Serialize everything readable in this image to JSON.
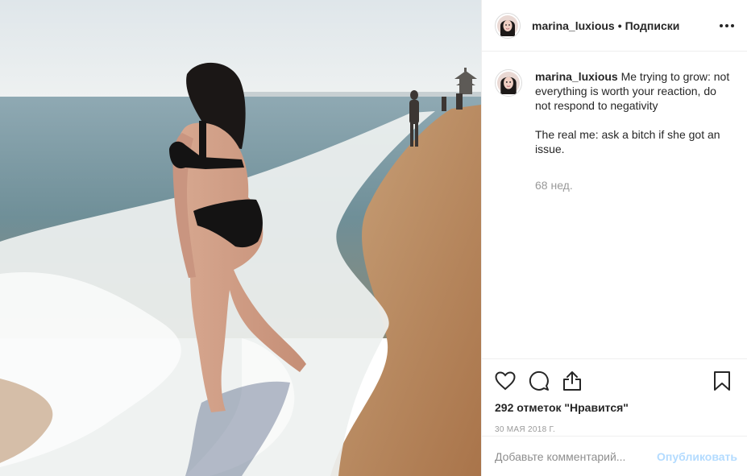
{
  "post": {
    "username": "marina_luxious",
    "separator": "•",
    "follow_label": "Подписки",
    "caption_line1": "Me trying to grow: not everything is worth your reaction, do not respond to negativity",
    "caption_line2": "The real me: ask a bitch if she got an issue.",
    "caption_age": "68 нед.",
    "likes": "292 отметок \"Нравится\"",
    "date": "30 МАЯ 2018 Г.",
    "comment_placeholder": "Добавьте комментарий...",
    "publish_label": "Опубликовать"
  },
  "icons": {
    "more": "more-options-icon",
    "like": "heart-icon",
    "comment": "comment-icon",
    "share": "share-icon",
    "save": "bookmark-icon"
  },
  "colors": {
    "text": "#262626",
    "muted": "#999999",
    "publish_disabled": "#b3dbff",
    "border": "#efefef"
  }
}
